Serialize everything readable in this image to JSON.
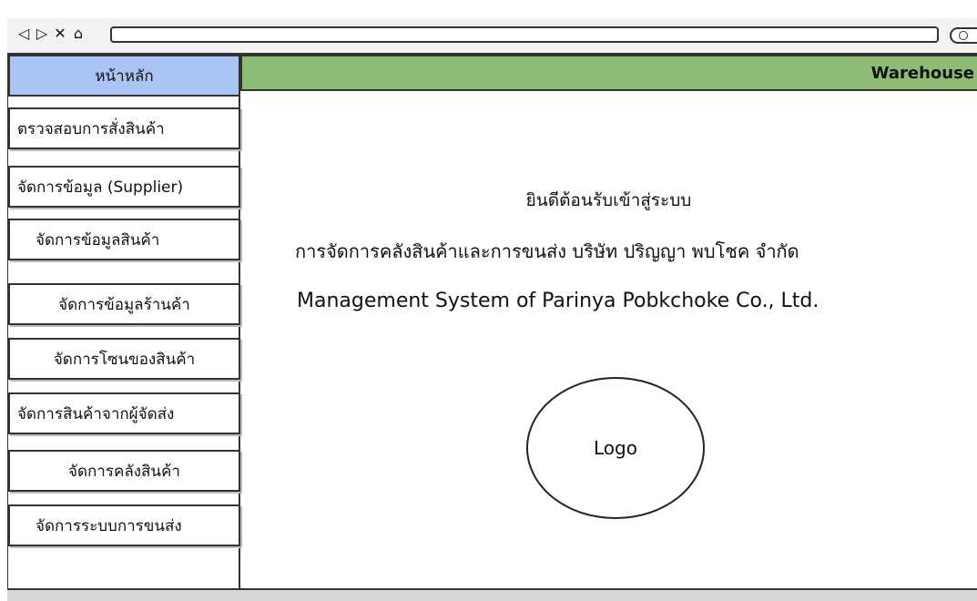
{
  "browser": {
    "nav_icons": [
      "◁",
      "▷",
      "✕",
      "⌂"
    ],
    "url": ""
  },
  "home_tab": {
    "label": "หน้าหลัก"
  },
  "header": {
    "title": "Warehouse",
    "color": "#8fbc74"
  },
  "sidebar": {
    "items": [
      {
        "label": "ตรวจสอบการสั่งสินค้า"
      },
      {
        "label": "จัดการข้อมูล (Supplier)"
      },
      {
        "label": "จัดการข้อมูลสินค้า"
      },
      {
        "label": "จัดการข้อมูลร้านค้า"
      },
      {
        "label": "จัดการโซนของสินค้า"
      },
      {
        "label": "จัดการสินค้าจากผู้จัดส่ง"
      },
      {
        "label": "จัดการคลังสินค้า"
      },
      {
        "label": "จัดการระบบการขนส่ง"
      }
    ]
  },
  "main": {
    "welcome": "ยินดีต้อนรับเข้าสู่ระบบ",
    "thai_title": "การจัดการคลังสินค้าและการขนส่ง บริษัท ปริญญา พบโชค จำกัด",
    "english_title": "Management System of Parinya Pobkchoke Co., Ltd.",
    "logo_label": "Logo"
  },
  "colors": {
    "home_tab": "#a9c4f5",
    "header": "#8fbc74"
  }
}
